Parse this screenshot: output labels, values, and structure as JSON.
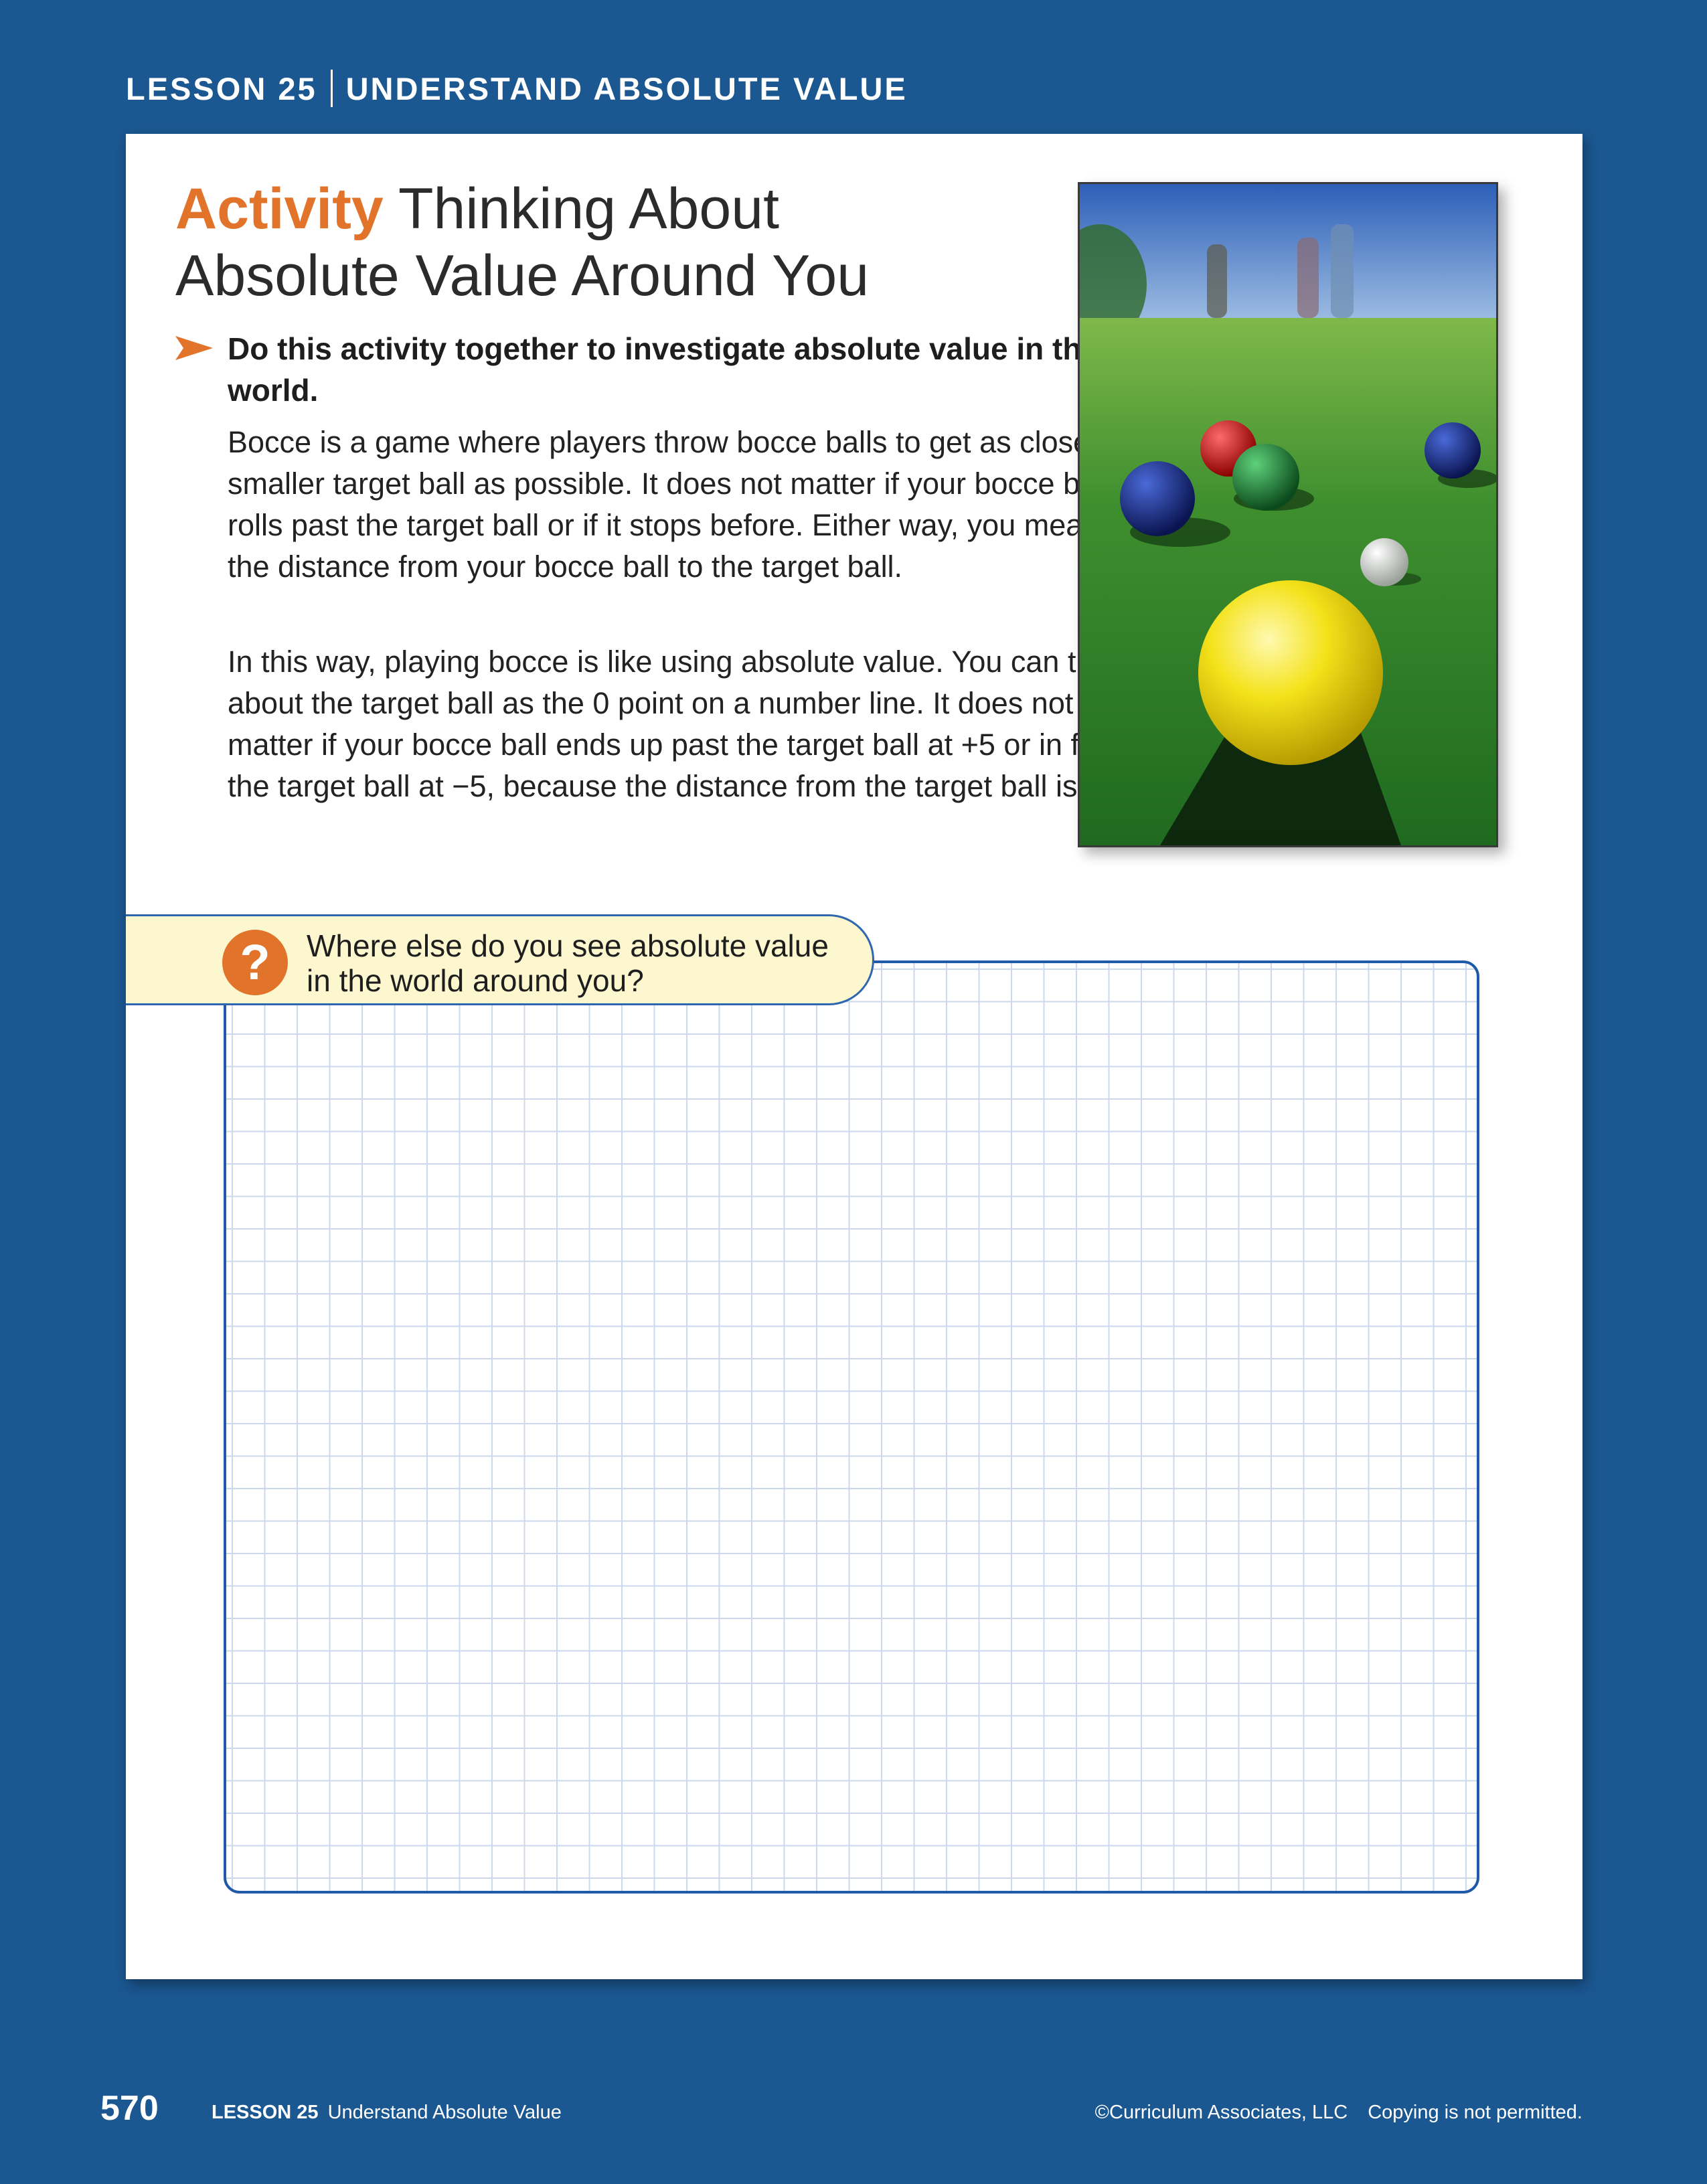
{
  "header": {
    "lesson": "LESSON 25",
    "title": "UNDERSTAND ABSOLUTE VALUE"
  },
  "activity": {
    "keyword": "Activity",
    "title_line1": " Thinking About",
    "title_line2": "Absolute Value Around You",
    "instruction": "Do this activity together to investigate absolute value in the real world.",
    "paragraph1": "Bocce is a game where players throw bocce balls to get as close to a smaller target ball as possible. It does not matter if your bocce ball rolls past the target ball or if it stops before. Either way, you measure the distance from your bocce ball to the target ball.",
    "paragraph2": "In this way, playing bocce is like using absolute value. You can think about the target ball as the 0 point on a number line. It does not matter if your bocce ball ends up past the target ball at +5 or in front of the target ball at −5, because the distance from the target ball is still 5."
  },
  "question": {
    "icon": "question-mark-icon",
    "symbol": "?",
    "text_line1": "Where else do you see absolute value",
    "text_line2": "in the world around you?"
  },
  "footer": {
    "page_number": "570",
    "lesson": "LESSON 25",
    "lesson_title": "Understand Absolute Value",
    "copyright": "©Curriculum Associates, LLC",
    "notice": "Copying is not permitted."
  },
  "colors": {
    "page_background": "#1b5791",
    "accent_orange": "#e2732a",
    "grid_border": "#1f5aa8",
    "question_background": "#fdf7cf"
  }
}
